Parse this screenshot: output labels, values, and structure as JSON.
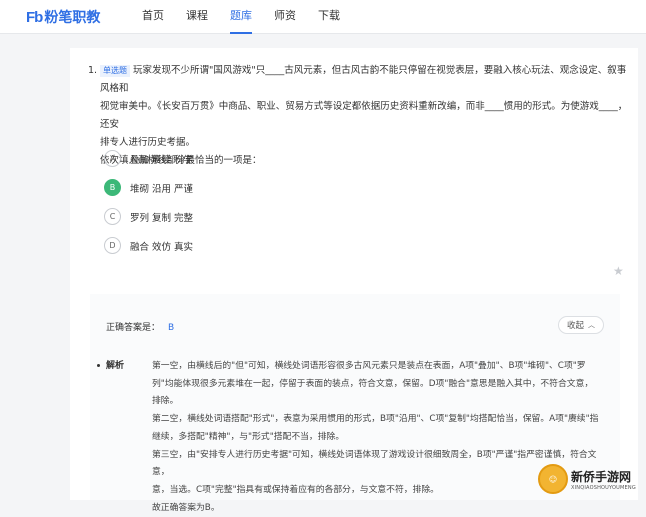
{
  "brand": {
    "mark": "Fb",
    "name": "粉笔职教"
  },
  "nav": [
    "首页",
    "课程",
    "题库",
    "师资",
    "下载"
  ],
  "nav_active": "题库",
  "question": {
    "number": "1.",
    "tag": "单选题",
    "lines": [
      "玩家发现不少所谓\"国风游戏\"只____古风元素，但古风古韵不能只停留在视觉表层，要融入核心玩法、观念设定、叙事风格和",
      "视觉审美中。《长安百万贯》中商品、职业、贸易方式等设定都依据历史资料重新改编，而非____惯用的形式。为使游戏____，还安",
      "排专人进行历史考据。",
      "依次填入画横线部分最恰当的一项是："
    ]
  },
  "options": [
    {
      "letter": "A",
      "text": "叠加 赓续 科学",
      "selected": false
    },
    {
      "letter": "B",
      "text": "堆砌 沿用 严谨",
      "selected": true
    },
    {
      "letter": "C",
      "text": "罗列 复制 完整",
      "selected": false
    },
    {
      "letter": "D",
      "text": "融合 效仿 真实",
      "selected": false
    }
  ],
  "answer": {
    "label": "正确答案是：",
    "value": "B",
    "collapse_label": "收起"
  },
  "analysis": {
    "label": "解析",
    "lines": [
      "第一空，由横线后的\"但\"可知，横线处词语形容很多古风元素只是装点在表面，A项\"叠加\"、B项\"堆砌\"、C项\"罗",
      "列\"均能体现很多元素堆在一起，停留于表面的装点，符合文意，保留。D项\"融合\"意思是融入其中，不符合文意，",
      "排除。",
      "第二空，横线处词语搭配\"形式\"，表意为采用惯用的形式，B项\"沿用\"、C项\"复制\"均搭配恰当，保留。A项\"赓续\"指",
      "继续，多搭配\"精神\"，与\"形式\"搭配不当，排除。",
      "第三空，由\"安排专人进行历史考据\"可知，横线处词语体现了游戏设计很细致周全，B项\"严谨\"指严密谨慎，符合文意，",
      "意，当选。C项\"完整\"指具有或保持着应有的各部分，与文意不符，排除。",
      "故正确答案为B。"
    ]
  },
  "watermark": {
    "cn": "新侨手游网",
    "en": "XINQIAOSHOUYOUMENG"
  },
  "colors": {
    "accent": "#2f6fe4",
    "selected": "#3cb878"
  }
}
